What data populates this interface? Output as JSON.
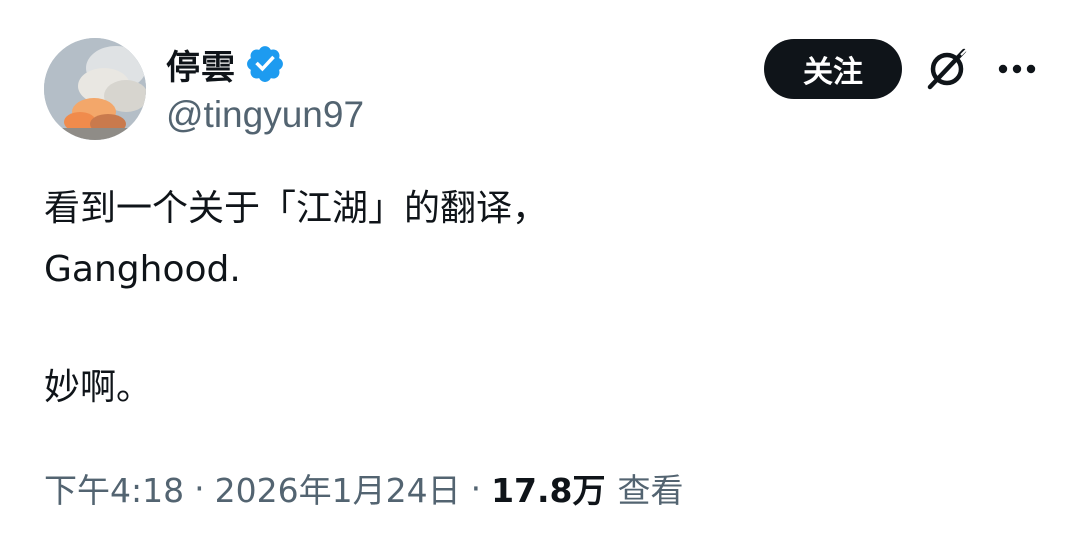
{
  "author": {
    "display_name": "停雲",
    "handle": "@tingyun97",
    "verified": true
  },
  "actions": {
    "follow_label": "关注",
    "grok_icon": "grok-icon",
    "more_icon": "more-icon"
  },
  "tweet": {
    "lines": [
      "看到一个关于「江湖」的翻译，",
      "Ganghood.",
      "",
      "妙啊。"
    ]
  },
  "meta": {
    "time": "下午4:18",
    "separator": "·",
    "date": "2026年1月24日",
    "views_count": "17.8万",
    "views_label": "查看"
  },
  "colors": {
    "text": "#0f1419",
    "secondary": "#536471",
    "verified_blue": "#1d9bf0",
    "follow_bg": "#0f1419"
  }
}
